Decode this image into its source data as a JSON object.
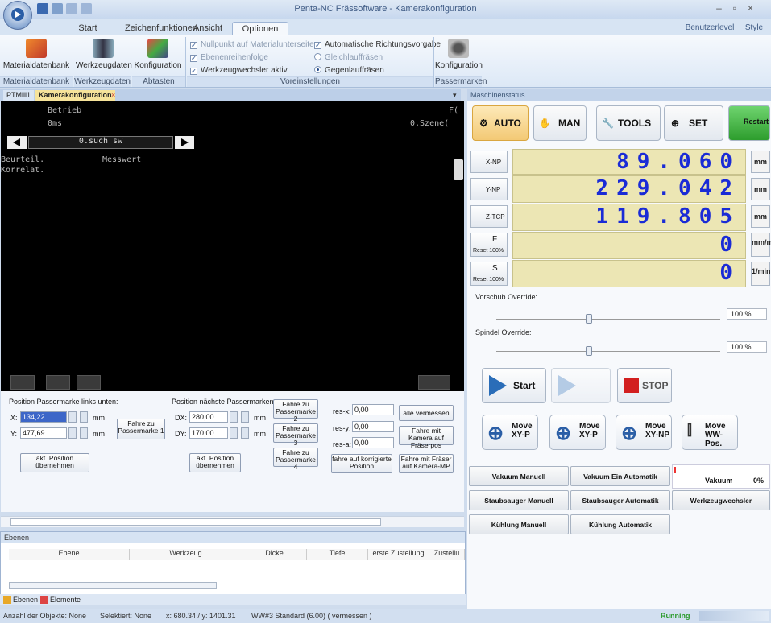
{
  "window": {
    "title": "Penta-NC Frässoftware - Kamerakonfiguration"
  },
  "tabs": [
    "Start",
    "Zeichenfunktionen",
    "Ansicht",
    "Optionen"
  ],
  "user_menu": {
    "benutzerlevel": "Benutzerlevel",
    "style": "Style"
  },
  "ribbon": {
    "buttons": [
      "Materialdatenbank",
      "Werkzeugdaten",
      "Konfiguration",
      "Konfiguration"
    ],
    "groups": [
      "Materialdatenbank",
      "Werkzeugdaten",
      "Abtasten",
      "Voreinstellungen",
      "Passermarken"
    ],
    "options": {
      "nullpunkt": "Nullpunkt auf Materialunterseite",
      "ebenenreihenfolge": "Ebenenreihenfolge",
      "werkzeugwechsler": "Werkzeugwechsler aktiv",
      "richtung": "Automatische Richtungsvorgabe",
      "gleich": "Gleichlauffräsen",
      "gegen": "Gegenlauffräsen"
    }
  },
  "doctabs": [
    "PTMill1",
    "Kamerakonfiguration"
  ],
  "camera": {
    "line1": "Betrieb",
    "line1r": "F(",
    "line2": "0ms",
    "line2r": "0.Szene(",
    "nav": "0.such sw",
    "r1": "Beurteil.",
    "r1b": "Messwert",
    "r2": "Korrelat."
  },
  "passermarke": {
    "links_unten": "Position Passermarke links unten:",
    "naechste": "Position nächste Passermarken:",
    "x_label": "X:",
    "y_label": "Y:",
    "x": "134,22",
    "y": "477,69",
    "mm": "mm",
    "dx_label": "DX:",
    "dy_label": "DY:",
    "dx": "280,00",
    "dy": "170,00",
    "fahre1": "Fahre zu Passermarke 1",
    "fahre2": "Fahre zu Passermarke 2",
    "fahre3": "Fahre zu Passermarke 3",
    "fahre4": "Fahre zu Passermarke 4",
    "akt1": "akt. Position übernehmen",
    "akt2": "akt. Position übernehmen",
    "resx_label": "res-x:",
    "resy_label": "res-y:",
    "resa_label": "res-a:",
    "resx": "0,00",
    "resy": "0,00",
    "resa": "0,00",
    "alle": "alle vermessen",
    "fahre_kamera": "Fahre mit Kamera auf Fräserpos",
    "fahre_korr": "fahre auf korrigierte Position",
    "fahre_fraeser": "Fahre mit Fräser auf Kamera-MP"
  },
  "ebenen": {
    "title": "Ebenen",
    "columns": [
      "Ebene",
      "Werkzeug",
      "Dicke",
      "Tiefe",
      "erste Zustellung",
      "Zustellu"
    ],
    "tabs": [
      "Ebenen",
      "Elemente"
    ]
  },
  "status": {
    "objekte": "Anzahl der Objekte: None",
    "selektiert": "Selektiert: None",
    "coords": "x: 680.34 / y: 1401.31",
    "tool": "WW#3 Standard (6.00) ( vermessen )",
    "running": "Running"
  },
  "maschine": {
    "title": "Maschinenstatus",
    "modes": [
      "AUTO",
      "MAN",
      "TOOLS",
      "SET",
      "Restart"
    ],
    "axes": [
      {
        "label": "X-NP",
        "value": "89.060",
        "unit": "mm"
      },
      {
        "label": "Y-NP",
        "value": "229.042",
        "unit": "mm"
      },
      {
        "label": "Z-TCP",
        "value": "119.805",
        "unit": "mm"
      },
      {
        "label": "F",
        "sub": "Reset 100%",
        "value": "0",
        "unit": "mm/min."
      },
      {
        "label": "S",
        "sub": "Reset 100%",
        "value": "0",
        "unit": "1/min."
      }
    ],
    "vorschub_label": "Vorschub Override:",
    "vorschub": "100 %",
    "spindel_label": "Spindel Override:",
    "spindel": "100 %",
    "vorschub_level": 0.4,
    "spindel_level": 0.4,
    "start": "Start",
    "stop": "STOP",
    "move": [
      "Move XY-P",
      "Move XY-P",
      "Move XY-NP",
      "Move WW-Pos."
    ],
    "grid": [
      "Vakuum Manuell",
      "Vakuum Ein Automatik",
      "Vakuum",
      "0%",
      "Staubsauger Manuell",
      "Staubsauger Automatik",
      "Werkzeugwechsler",
      "Kühlung Manuell",
      "Kühlung Automatik"
    ]
  }
}
